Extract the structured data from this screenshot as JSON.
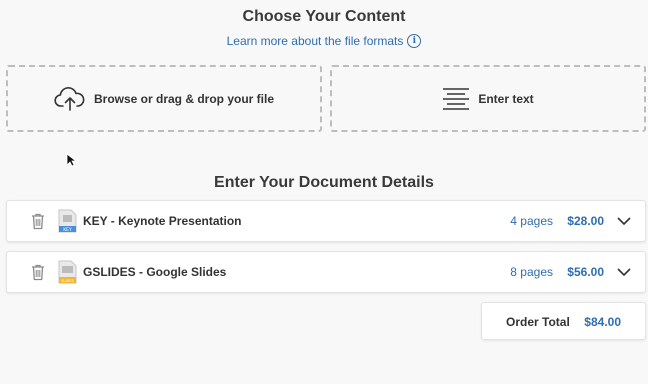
{
  "content_section": {
    "title": "Choose Your Content",
    "learn_more": "Learn more about the file formats",
    "upload_label": "Browse or drag & drop your file",
    "enter_text_label": "Enter text"
  },
  "details_section": {
    "title": "Enter Your Document Details",
    "items": [
      {
        "name": "KEY - Keynote Presentation",
        "pages": "4 pages",
        "price": "$28.00",
        "icon_tag": "KEY",
        "icon_color": "#4a90d9"
      },
      {
        "name": "GSLIDES - Google Slides",
        "pages": "8 pages",
        "price": "$56.00",
        "icon_tag": "SLIDES",
        "icon_color": "#f2b632"
      }
    ]
  },
  "order": {
    "label": "Order Total",
    "value": "$84.00"
  },
  "colors": {
    "accent": "#2f6db0"
  },
  "icons": [
    "info-icon",
    "cloud-upload-icon",
    "text-lines-icon",
    "trash-icon",
    "keynote-file-icon",
    "slides-file-icon",
    "chevron-down-icon",
    "cursor-icon"
  ]
}
